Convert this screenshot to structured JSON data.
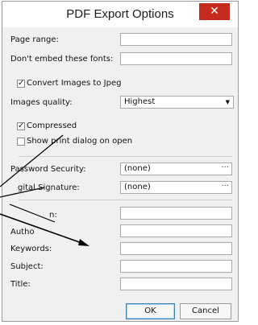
{
  "dialog": {
    "title": "PDF Export Options",
    "close_glyph": "✕"
  },
  "fields": {
    "page_range": {
      "label": "Page range:",
      "value": ""
    },
    "dont_embed_fonts": {
      "label": "Don't embed these fonts:",
      "value": ""
    },
    "convert_images": {
      "label": "Convert Images to Jpeg",
      "checked": true
    },
    "images_quality": {
      "label": "Images quality:",
      "value": "Highest"
    },
    "compressed": {
      "label": "Compressed",
      "checked": true
    },
    "show_print_dialog": {
      "label": "Show print dialog on open",
      "checked": false
    },
    "password_security": {
      "label": "Password Security:",
      "value": "(none)"
    },
    "digital_signature": {
      "label": "gital Signature:",
      "value": "(none)"
    },
    "application": {
      "label": "n:",
      "value": ""
    },
    "author": {
      "label": "Autho",
      "value": ""
    },
    "keywords": {
      "label": "Keywords:",
      "value": ""
    },
    "subject": {
      "label": "Subject:",
      "value": ""
    },
    "title": {
      "label": "Title:",
      "value": ""
    }
  },
  "ellipsis": "···",
  "check_glyph": "✓",
  "dropdown_glyph": "▼",
  "buttons": {
    "ok": "OK",
    "cancel": "Cancel"
  },
  "colors": {
    "close_button": "#c42b1c",
    "ok_border": "#3c7fb1"
  }
}
